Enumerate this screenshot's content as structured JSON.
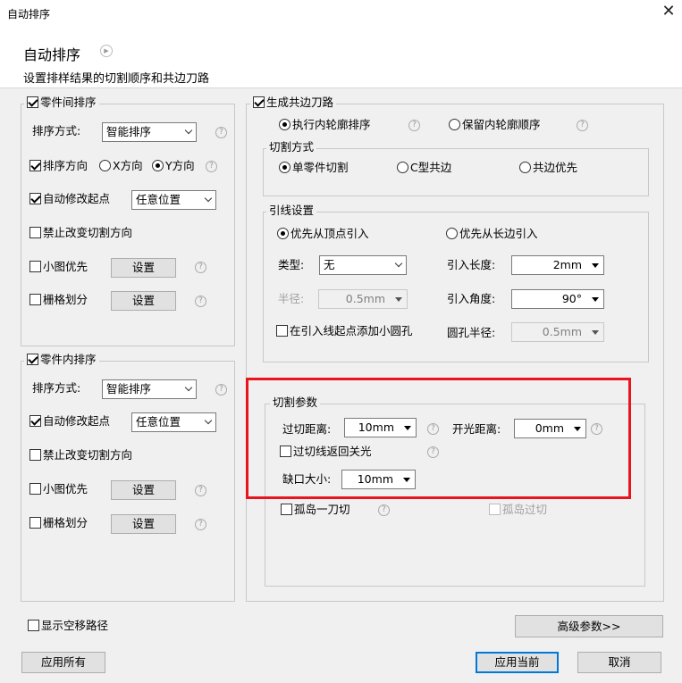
{
  "window": {
    "title": "自动排序",
    "close_icon": "close-icon"
  },
  "header": {
    "title": "自动排序",
    "subtitle": "设置排样结果的切割顺序和共边刀路"
  },
  "between_parts": {
    "group_label": "零件间排序",
    "group_checked": true,
    "method_label": "排序方式:",
    "method_value": "智能排序",
    "direction_label": "排序方向",
    "direction_checked": true,
    "dir_x_label": "X方向",
    "dir_y_label": "Y方向",
    "dir_selected": "Y",
    "auto_start_label": "自动修改起点",
    "auto_start_checked": true,
    "auto_start_value": "任意位置",
    "forbid_label": "禁止改变切割方向",
    "forbid_checked": false,
    "small_first_label": "小图优先",
    "small_first_checked": false,
    "small_first_button": "设置",
    "grid_label": "栅格划分",
    "grid_checked": false,
    "grid_button": "设置"
  },
  "within_parts": {
    "group_label": "零件内排序",
    "group_checked": true,
    "method_label": "排序方式:",
    "method_value": "智能排序",
    "auto_start_label": "自动修改起点",
    "auto_start_checked": true,
    "auto_start_value": "任意位置",
    "forbid_label": "禁止改变切割方向",
    "forbid_checked": false,
    "small_first_label": "小图优先",
    "small_first_checked": false,
    "small_first_button": "设置",
    "grid_label": "栅格划分",
    "grid_checked": false,
    "grid_button": "设置"
  },
  "common_edge": {
    "group_label": "生成共边刀路",
    "group_checked": true,
    "inner_order_label": "执行内轮廓排序",
    "keep_order_label": "保留内轮廓顺序",
    "selected": "inner"
  },
  "cut_mode": {
    "group_label": "切割方式",
    "single_label": "单零件切割",
    "c_label": "C型共边",
    "common_label": "共边优先",
    "selected": "single"
  },
  "lead": {
    "group_label": "引线设置",
    "vertex_label": "优先从顶点引入",
    "long_edge_label": "优先从长边引入",
    "selected": "vertex",
    "type_label": "类型:",
    "type_value": "无",
    "radius_label": "半径:",
    "radius_value": "0.5mm",
    "length_label": "引入长度:",
    "length_value": "2mm",
    "angle_label": "引入角度:",
    "angle_value": "90°",
    "hole_label": "在引入线起点添加小圆孔",
    "hole_checked": false,
    "hole_radius_label": "圆孔半径:",
    "hole_radius_value": "0.5mm"
  },
  "cut_params": {
    "group_label": "切割参数",
    "overcut_label": "过切距离:",
    "overcut_value": "10mm",
    "open_label": "开光距离:",
    "open_value": "0mm",
    "return_label": "过切线返回关光",
    "return_checked": false,
    "gap_label": "缺口大小:",
    "gap_value": "10mm",
    "island_label": "孤岛一刀切",
    "island_checked": false,
    "island_over_label": "孤岛过切",
    "island_over_checked": false
  },
  "bottom": {
    "show_path_label": "显示空移路径",
    "show_path_checked": false,
    "advanced_label": "高级参数>>",
    "apply_all_label": "应用所有",
    "apply_current_label": "应用当前",
    "cancel_label": "取消"
  },
  "colors": {
    "highlight": "#e8141e",
    "accent": "#0078d7"
  },
  "help_glyph": "?",
  "play_glyph": "▶"
}
